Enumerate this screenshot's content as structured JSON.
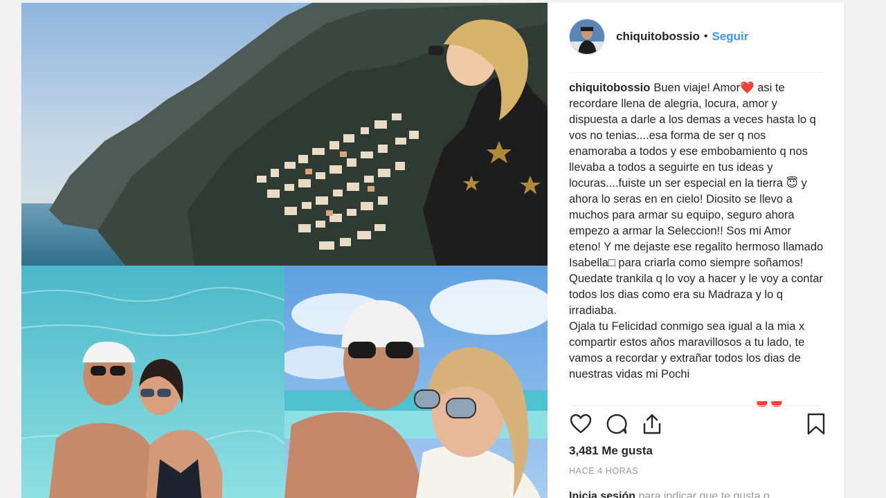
{
  "account": {
    "username": "chiquitobossio",
    "follow_label": "Seguir",
    "separator": "•"
  },
  "caption": {
    "username": "chiquitobossio",
    "text_part1": "Buen viaje! Amor",
    "heart": "❤️",
    "text_part2": " asi te recordare llena de alegria, locura, amor y dispuesta a darle a los demas a veces hasta lo q vos no tenias....esa forma de ser q nos enamoraba a todos y ese embobamiento q nos llevaba a todos a seguirte en tus ideas y locuras....fuiste un ser especial en la tierra ",
    "halo_emoji": "😇",
    "text_part3": " y ahora lo seras en en cielo! Diosito se llevo a muchos para armar su equipo, seguro ahora empezo a armar la Seleccion!! Sos mi Amor eteno! Y me dejaste ese regalito hermoso llamado Isabella□ para criarla como siempre soñamos! Quedate trankila q lo voy a hacer y le voy a contar todos los dias como era su Madraza y lo q irradiaba.",
    "text_paragraph2": "Ojala tu Felicidad conmigo sea igual a la mia x compartir estos años maravillosos a tu lado, te vamos a recordar y extrañar todos los dias de nuestras vidas mi Pochi"
  },
  "actions": {
    "like_icon": "heart-outline-icon",
    "comment_icon": "comment-bubble-icon",
    "share_icon": "share-upload-icon",
    "save_icon": "bookmark-icon"
  },
  "likes_text": "3,481 Me gusta",
  "timestamp": "HACE 4 HORAS",
  "login_prompt": {
    "link": "Inicia sesión",
    "rest": " para indicar que te gusta o"
  },
  "colors": {
    "link_blue": "#3897f0",
    "text_dark": "#262626",
    "muted": "#999999"
  }
}
